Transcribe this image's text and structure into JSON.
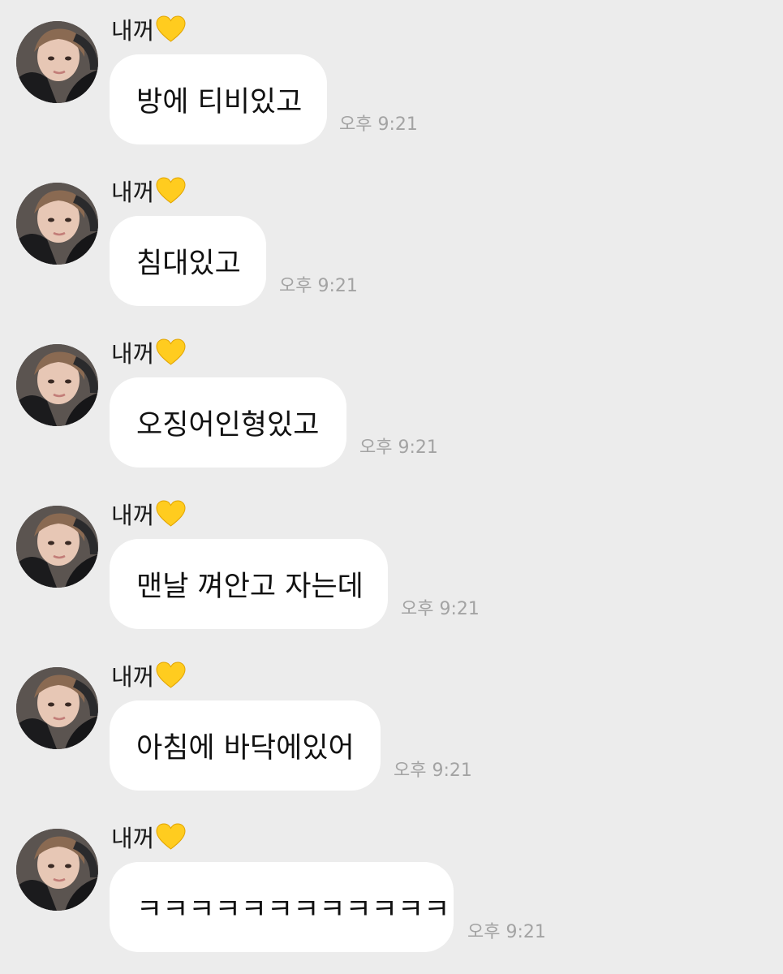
{
  "colors": {
    "background": "#ececec",
    "bubble": "#ffffff",
    "timestamp": "#a3a3a3",
    "heart": "#ffcc1f"
  },
  "messages": [
    {
      "sender": "내꺼",
      "sender_emoji": "yellow-heart-icon",
      "text": "방에 티비있고",
      "time": "오후 9:21"
    },
    {
      "sender": "내꺼",
      "sender_emoji": "yellow-heart-icon",
      "text": "침대있고",
      "time": "오후 9:21"
    },
    {
      "sender": "내꺼",
      "sender_emoji": "yellow-heart-icon",
      "text": "오징어인형있고",
      "time": "오후 9:21"
    },
    {
      "sender": "내꺼",
      "sender_emoji": "yellow-heart-icon",
      "text": "맨날 껴안고 자는데",
      "time": "오후 9:21"
    },
    {
      "sender": "내꺼",
      "sender_emoji": "yellow-heart-icon",
      "text": "아침에 바닥에있어",
      "time": "오후 9:21"
    },
    {
      "sender": "내꺼",
      "sender_emoji": "yellow-heart-icon",
      "text": "ㅋㅋㅋㅋㅋㅋㅋㅋㅋㅋㅋㅋ",
      "time": "오후 9:21"
    }
  ]
}
